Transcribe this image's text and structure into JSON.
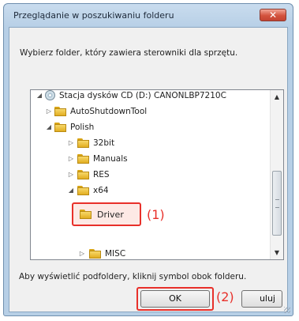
{
  "dialog": {
    "title": "Przeglądanie w poszukiwaniu folderu",
    "close_label": "✕",
    "instruction": "Wybierz folder, który zawiera sterowniki dla sprzętu.",
    "hint": "Aby wyświetlić podfoldery, kliknij symbol obok folderu."
  },
  "tree": {
    "items": [
      {
        "label": "Stacja dysków CD (D:) CANONLBP7210C",
        "icon": "cd-drive-icon",
        "expander": "◢",
        "depth": 0
      },
      {
        "label": "AutoShutdownTool",
        "icon": "folder-icon",
        "expander": "▷",
        "depth": 1
      },
      {
        "label": "Polish",
        "icon": "folder-icon",
        "expander": "◢",
        "depth": 1
      },
      {
        "label": "32bit",
        "icon": "folder-icon",
        "expander": "▷",
        "depth": 2
      },
      {
        "label": "Manuals",
        "icon": "folder-icon",
        "expander": "▷",
        "depth": 2
      },
      {
        "label": "RES",
        "icon": "folder-icon",
        "expander": "▷",
        "depth": 2
      },
      {
        "label": "x64",
        "icon": "folder-icon",
        "expander": "◢",
        "depth": 2
      },
      {
        "label": "Driver",
        "icon": "folder-icon",
        "expander": "",
        "depth": 3,
        "selected": true
      },
      {
        "label": "MISC",
        "icon": "folder-icon",
        "expander": "▷",
        "depth": 3
      }
    ]
  },
  "callouts": {
    "one": "(1)",
    "two": "(2)"
  },
  "buttons": {
    "ok": "OK",
    "cancel_partial": "uluj"
  },
  "colors": {
    "highlight": "#e8302a",
    "titlebar": "#c9dcee",
    "close": "#d3533e"
  }
}
